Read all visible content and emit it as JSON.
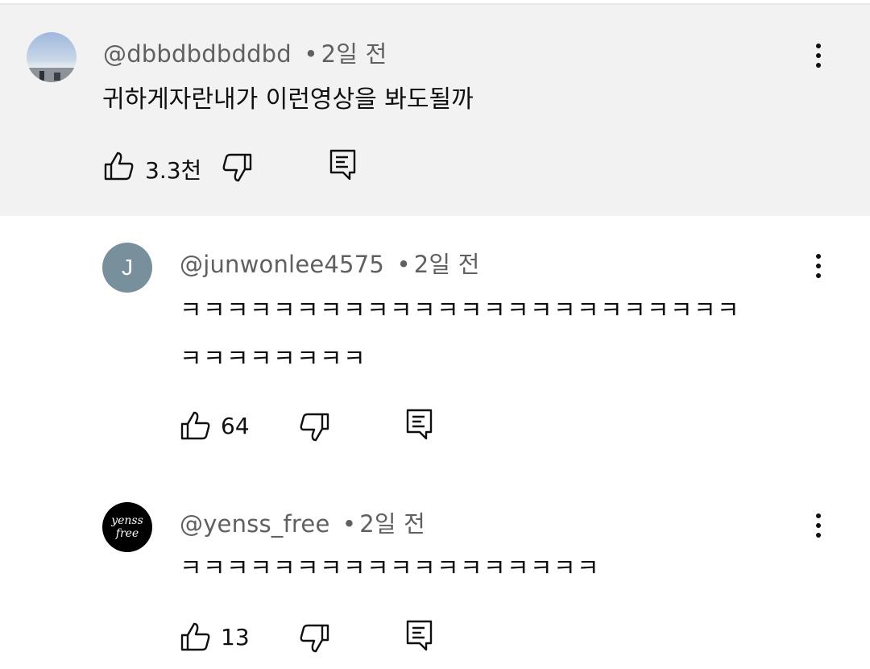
{
  "comments": [
    {
      "handle": "@dbbdbdbddbd",
      "time": "2일 전",
      "text": "귀하게자란내가 이런영상을 봐도될까",
      "likes": "3.3천",
      "avatar": {
        "type": "photo-sky"
      }
    },
    {
      "handle": "@junwonlee4575",
      "time": "2일 전",
      "text_lines": [
        "ㅋㅋㅋㅋㅋㅋㅋㅋㅋㅋㅋㅋㅋㅋㅋㅋㅋㅋㅋㅋㅋㅋㅋㅋ",
        "ㅋㅋㅋㅋㅋㅋㅋㅋ"
      ],
      "likes": "64",
      "avatar": {
        "type": "letter",
        "letter": "J",
        "color": "#78909c"
      }
    },
    {
      "handle": "@yenss_free",
      "time": "2일 전",
      "text": "ㅋㅋㅋㅋㅋㅋㅋㅋㅋㅋㅋㅋㅋㅋㅋㅋㅋㅋ",
      "likes": "13",
      "avatar": {
        "type": "logo",
        "line1": "yenss",
        "line2": "free",
        "color": "#000000"
      }
    }
  ],
  "meta_separator": "•",
  "icons": {
    "like": "thumbs-up-icon",
    "dislike": "thumbs-down-icon",
    "reply": "reply-icon",
    "more": "more-vert-icon"
  }
}
